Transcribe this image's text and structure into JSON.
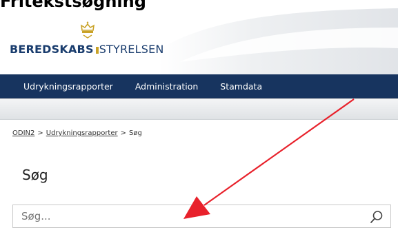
{
  "caption": {
    "title": "Fritekstsøgning"
  },
  "brand": {
    "logo_bold": "BEREDSKABS",
    "logo_light": "STYRELSEN"
  },
  "nav": {
    "items": [
      "Udrykningsrapporter",
      "Administration",
      "Stamdata"
    ]
  },
  "breadcrumb": {
    "root": "ODIN2",
    "section": "Udrykningsrapporter",
    "current": "Søg",
    "separator": ">"
  },
  "page": {
    "title": "Søg"
  },
  "search": {
    "placeholder": "Søg..."
  },
  "icons": {
    "search": "search-icon",
    "crown": "crown-icon",
    "annotation": "red-arrow"
  },
  "colors": {
    "nav_bg": "#17345f",
    "brand_text": "#1a3d6e",
    "brand_gold": "#c9a227",
    "annotation_arrow": "#e8212b"
  }
}
